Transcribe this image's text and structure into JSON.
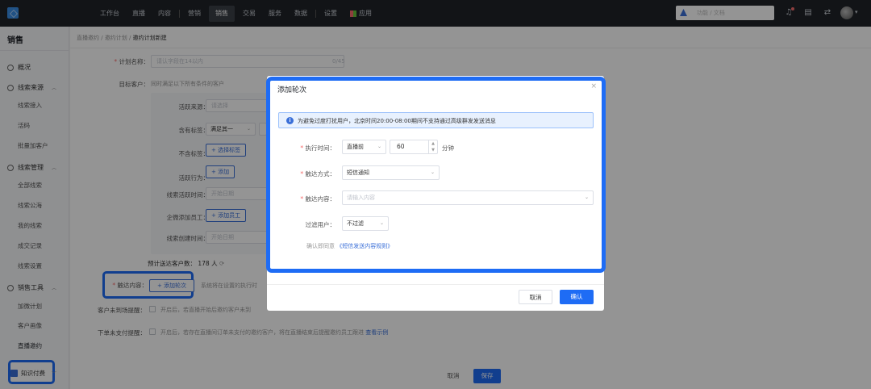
{
  "topnav": {
    "items": [
      "工作台",
      "直播",
      "内容",
      "营销",
      "销售",
      "交易",
      "服务",
      "数据",
      "设置",
      "应用"
    ],
    "active": "销售",
    "search_placeholder": "功能 / 文档"
  },
  "sidebar": {
    "title": "销售",
    "sections": [
      {
        "label": "概况"
      },
      {
        "label": "线索来源",
        "items": [
          "线索接入",
          "活码",
          "批量加客户"
        ]
      },
      {
        "label": "线索管理",
        "items": [
          "全部线索",
          "线索公海",
          "我的线索",
          "成交记录",
          "线索设置"
        ]
      },
      {
        "label": "销售工具",
        "items": [
          "加微计划",
          "客户画像",
          "直播邀约"
        ]
      }
    ],
    "active_item": "直播邀约",
    "bottom": "知识付费"
  },
  "breadcrumb": [
    "直播邀约",
    "邀约计划",
    "邀约计划新建"
  ],
  "form": {
    "plan_name_label": "计划名称：",
    "plan_name_placeholder": "请认字段在14以内",
    "plan_name_count": "0/45",
    "target_label": "目标客户：",
    "target_hint": "同时满足以下所有条件的客户",
    "filters": {
      "active_source_label": "活跃来源：",
      "active_source_placeholder": "请选择",
      "tag_include_label": "含有标签：",
      "tag_include_value": "满足其一",
      "tag_exclude_label": "不含标签：",
      "select_tag_button": "+ 选择标签",
      "active_behavior_label": "活跃行为：",
      "add_button": "+ 添加",
      "lead_active_time_label": "线索活跃时间：",
      "lead_active_time_placeholder": "开始日期",
      "wecom_staff_label": "企微添加员工：",
      "add_staff_button": "+ 添加员工",
      "lead_created_time_label": "线索创建时间：",
      "lead_created_time_placeholder": "开始日期"
    },
    "estimate_label": "预计送达客户数：",
    "estimate_value": "178 人",
    "reach_content_label": "触达内容：",
    "add_round_button": "+ 添加轮次",
    "reach_hint": "系统将在设置的执行时",
    "no_enter_label": "客户未到场提醒：",
    "no_enter_hint": "开启后，若直播开始后邀约客户未到",
    "unpaid_label": "下单未支付提醒：",
    "unpaid_hint": "开启后，若存在直播间订单未支付的邀约客户，将在直播结束后提醒邀约员工跟进",
    "unpaid_link": "查看示例",
    "cancel": "取消",
    "save": "保存"
  },
  "dialog": {
    "title": "添加轮次",
    "close": "×",
    "alert": "为避免过度打扰用户，北京时间20:00-08:00期间不支持通过高级群发发送消息",
    "exec_time_label": "执行时间：",
    "exec_time_select": "直播前",
    "exec_time_value": "60",
    "exec_time_unit": "分钟",
    "reach_method_label": "触达方式：",
    "reach_method_value": "短信通知",
    "reach_content_label": "触达内容：",
    "reach_content_placeholder": "请输入内容",
    "filter_users_label": "过滤用户：",
    "filter_users_value": "不过滤",
    "agree_prefix": "确认即同意",
    "agree_link": "《短信发送内容规则》",
    "cancel": "取消",
    "confirm": "确认"
  },
  "colors": {
    "primary": "#1e6cf5",
    "topbar": "#1f2329",
    "alert_bg": "#e8f1fe"
  }
}
